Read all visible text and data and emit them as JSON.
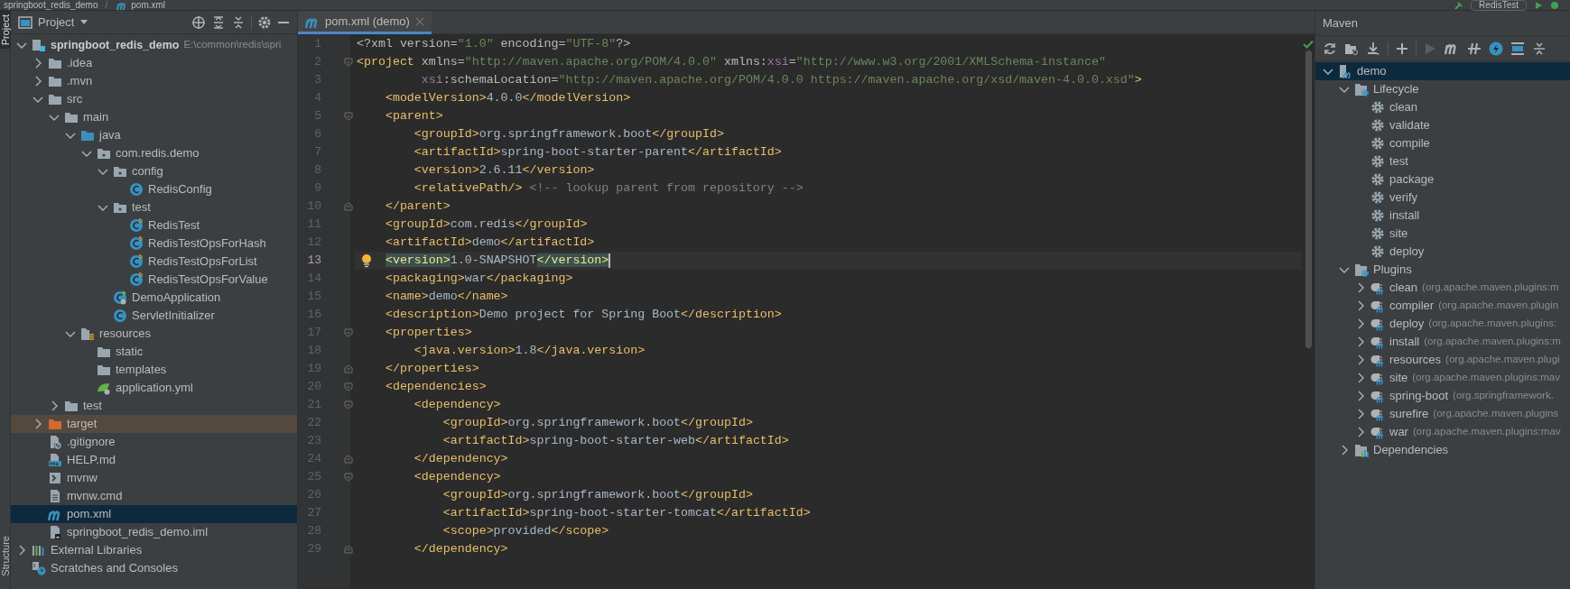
{
  "top_bar": {
    "separator": "/",
    "breadcrumbs": [
      {
        "label": "springboot_redis_demo",
        "kind": "module"
      },
      {
        "label": "pom.xml",
        "kind": "maven"
      }
    ],
    "run_config": "RedisTest"
  },
  "side_tabs": [
    {
      "label": "Project",
      "selected": true
    },
    {
      "label": "Structure",
      "selected": false
    }
  ],
  "project_panel": {
    "title": "Project",
    "tree": [
      {
        "label": "springboot_redis_demo",
        "hint": "E:\\common\\redis\\spri",
        "kind": "module",
        "expanded": true,
        "selected": false,
        "children": [
          {
            "label": ".idea",
            "kind": "folder",
            "expanded": false,
            "selected": false
          },
          {
            "label": ".mvn",
            "kind": "folder",
            "expanded": false,
            "selected": false
          },
          {
            "label": "src",
            "kind": "folder",
            "expanded": true,
            "selected": false,
            "children": [
              {
                "label": "main",
                "kind": "folder",
                "expanded": true,
                "selected": false,
                "children": [
                  {
                    "label": "java",
                    "kind": "source-folder",
                    "expanded": true,
                    "selected": false,
                    "children": [
                      {
                        "label": "com.redis.demo",
                        "kind": "package",
                        "expanded": true,
                        "selected": false,
                        "children": [
                          {
                            "label": "config",
                            "kind": "package",
                            "expanded": true,
                            "selected": false,
                            "children": [
                              {
                                "label": "RedisConfig",
                                "kind": "class",
                                "selected": false
                              }
                            ]
                          },
                          {
                            "label": "test",
                            "kind": "package",
                            "expanded": true,
                            "selected": false,
                            "children": [
                              {
                                "label": "RedisTest",
                                "kind": "test-class",
                                "selected": false
                              },
                              {
                                "label": "RedisTestOpsForHash",
                                "kind": "test-class",
                                "selected": false
                              },
                              {
                                "label": "RedisTestOpsForList",
                                "kind": "test-class",
                                "selected": false
                              },
                              {
                                "label": "RedisTestOpsForValue",
                                "kind": "test-class",
                                "selected": false
                              }
                            ]
                          },
                          {
                            "label": "DemoApplication",
                            "kind": "spring-class",
                            "selected": false
                          },
                          {
                            "label": "ServletInitializer",
                            "kind": "class",
                            "selected": false
                          }
                        ]
                      }
                    ]
                  },
                  {
                    "label": "resources",
                    "kind": "resources-folder",
                    "expanded": true,
                    "selected": false,
                    "children": [
                      {
                        "label": "static",
                        "kind": "folder",
                        "selected": false
                      },
                      {
                        "label": "templates",
                        "kind": "folder",
                        "selected": false
                      },
                      {
                        "label": "application.yml",
                        "kind": "spring-config",
                        "selected": false
                      }
                    ]
                  }
                ]
              },
              {
                "label": "test",
                "kind": "folder",
                "expanded": false,
                "selected": false
              }
            ]
          },
          {
            "label": "target",
            "kind": "excluded-folder",
            "expanded": false,
            "selected": false
          },
          {
            "label": ".gitignore",
            "kind": "gitignore",
            "selected": false
          },
          {
            "label": "HELP.md",
            "kind": "markdown",
            "selected": false
          },
          {
            "label": "mvnw",
            "kind": "shell",
            "selected": false
          },
          {
            "label": "mvnw.cmd",
            "kind": "text-file",
            "selected": false
          },
          {
            "label": "pom.xml",
            "kind": "maven",
            "selected": true
          },
          {
            "label": "springboot_redis_demo.iml",
            "kind": "iml",
            "selected": false
          }
        ]
      },
      {
        "label": "External Libraries",
        "kind": "libraries",
        "expanded": false,
        "selected": false
      },
      {
        "label": "Scratches and Consoles",
        "kind": "scratches",
        "selected": false
      }
    ]
  },
  "editor": {
    "tabs": [
      {
        "label": "pom.xml (demo)",
        "selected": true
      }
    ],
    "lines": [
      {
        "number": "1",
        "current": false,
        "segments": [
          {
            "kind": "attr",
            "text": "<?xml version="
          },
          {
            "kind": "value",
            "text": "\"1.0\""
          },
          {
            "kind": "attr",
            "text": " encoding="
          },
          {
            "kind": "value",
            "text": "\"UTF-8\""
          },
          {
            "kind": "attr",
            "text": "?>"
          }
        ]
      },
      {
        "number": "2",
        "current": false,
        "kind": "fold-start",
        "segments": [
          {
            "kind": "tag",
            "text": "<project"
          },
          {
            "kind": "attr",
            "text": " xmlns="
          },
          {
            "kind": "value",
            "text": "\"http://maven.apache.org/POM/4.0.0\""
          },
          {
            "kind": "attr",
            "text": " xmlns:"
          },
          {
            "kind": "ns",
            "text": "xsi"
          },
          {
            "kind": "attr",
            "text": "="
          },
          {
            "kind": "value",
            "text": "\"http://www.w3.org/2001/XMLSchema-instance\""
          }
        ]
      },
      {
        "number": "3",
        "current": false,
        "segments": [
          {
            "kind": "ns",
            "text": "         xsi"
          },
          {
            "kind": "attr",
            "text": ":schemaLocation="
          },
          {
            "kind": "value",
            "text": "\"http://maven.apache.org/POM/4.0.0 https://maven.apache.org/xsd/maven-4.0.0.xsd\""
          },
          {
            "kind": "tag",
            "text": ">"
          }
        ]
      },
      {
        "number": "4",
        "current": false,
        "segments": [
          {
            "kind": "tag",
            "text": "    <modelVersion>"
          },
          {
            "kind": "text",
            "text": "4.0.0"
          },
          {
            "kind": "tag",
            "text": "</modelVersion>"
          }
        ]
      },
      {
        "number": "5",
        "current": false,
        "kind": "fold-start",
        "segments": [
          {
            "kind": "tag",
            "text": "    <parent>"
          }
        ]
      },
      {
        "number": "6",
        "current": false,
        "segments": [
          {
            "kind": "tag",
            "text": "        <groupId>"
          },
          {
            "kind": "text",
            "text": "org.springframework.boot"
          },
          {
            "kind": "tag",
            "text": "</groupId>"
          }
        ]
      },
      {
        "number": "7",
        "current": false,
        "segments": [
          {
            "kind": "tag",
            "text": "        <artifactId>"
          },
          {
            "kind": "text",
            "text": "spring-boot-starter-parent"
          },
          {
            "kind": "tag",
            "text": "</artifactId>"
          }
        ]
      },
      {
        "number": "8",
        "current": false,
        "segments": [
          {
            "kind": "tag",
            "text": "        <version>"
          },
          {
            "kind": "text",
            "text": "2.6.11"
          },
          {
            "kind": "tag",
            "text": "</version>"
          }
        ]
      },
      {
        "number": "9",
        "current": false,
        "segments": [
          {
            "kind": "tag",
            "text": "        <relativePath/>"
          },
          {
            "kind": "comment",
            "text": " <!-- lookup parent from repository -->"
          }
        ]
      },
      {
        "number": "10",
        "current": false,
        "kind": "fold-end",
        "segments": [
          {
            "kind": "tag",
            "text": "    </parent>"
          }
        ]
      },
      {
        "number": "11",
        "current": false,
        "segments": [
          {
            "kind": "tag",
            "text": "    <groupId>"
          },
          {
            "kind": "text",
            "text": "com.redis"
          },
          {
            "kind": "tag",
            "text": "</groupId>"
          }
        ]
      },
      {
        "number": "12",
        "current": false,
        "segments": [
          {
            "kind": "tag",
            "text": "    <artifactId>"
          },
          {
            "kind": "text",
            "text": "demo"
          },
          {
            "kind": "tag",
            "text": "</artifactId>"
          }
        ]
      },
      {
        "number": "13",
        "current": true,
        "bulb": true,
        "segments": [
          {
            "kind": "tag",
            "text": "    <version>",
            "matched": true
          },
          {
            "kind": "text",
            "text": "1.0-SNAPSHOT"
          },
          {
            "kind": "tag",
            "text": "</version>",
            "matched": true
          }
        ]
      },
      {
        "number": "14",
        "current": false,
        "segments": [
          {
            "kind": "tag",
            "text": "    <packaging>"
          },
          {
            "kind": "text",
            "text": "war"
          },
          {
            "kind": "tag",
            "text": "</packaging>"
          }
        ]
      },
      {
        "number": "15",
        "current": false,
        "segments": [
          {
            "kind": "tag",
            "text": "    <name>"
          },
          {
            "kind": "text",
            "text": "demo"
          },
          {
            "kind": "tag",
            "text": "</name>"
          }
        ]
      },
      {
        "number": "16",
        "current": false,
        "segments": [
          {
            "kind": "tag",
            "text": "    <description>"
          },
          {
            "kind": "text",
            "text": "Demo project for Spring Boot"
          },
          {
            "kind": "tag",
            "text": "</description>"
          }
        ]
      },
      {
        "number": "17",
        "current": false,
        "kind": "fold-start",
        "segments": [
          {
            "kind": "tag",
            "text": "    <properties>"
          }
        ]
      },
      {
        "number": "18",
        "current": false,
        "segments": [
          {
            "kind": "tag",
            "text": "        <java.version>"
          },
          {
            "kind": "text",
            "text": "1.8"
          },
          {
            "kind": "tag",
            "text": "</java.version>"
          }
        ]
      },
      {
        "number": "19",
        "current": false,
        "kind": "fold-end",
        "segments": [
          {
            "kind": "tag",
            "text": "    </properties>"
          }
        ]
      },
      {
        "number": "20",
        "current": false,
        "kind": "fold-start",
        "segments": [
          {
            "kind": "tag",
            "text": "    <dependencies>"
          }
        ]
      },
      {
        "number": "21",
        "current": false,
        "kind": "fold-start",
        "segments": [
          {
            "kind": "tag",
            "text": "        <dependency>"
          }
        ]
      },
      {
        "number": "22",
        "current": false,
        "segments": [
          {
            "kind": "tag",
            "text": "            <groupId>"
          },
          {
            "kind": "text",
            "text": "org.springframework.boot"
          },
          {
            "kind": "tag",
            "text": "</groupId>"
          }
        ]
      },
      {
        "number": "23",
        "current": false,
        "segments": [
          {
            "kind": "tag",
            "text": "            <artifactId>"
          },
          {
            "kind": "text",
            "text": "spring-boot-starter-web"
          },
          {
            "kind": "tag",
            "text": "</artifactId>"
          }
        ]
      },
      {
        "number": "24",
        "current": false,
        "kind": "fold-end",
        "segments": [
          {
            "kind": "tag",
            "text": "        </dependency>"
          }
        ]
      },
      {
        "number": "25",
        "current": false,
        "kind": "fold-start",
        "segments": [
          {
            "kind": "tag",
            "text": "        <dependency>"
          }
        ]
      },
      {
        "number": "26",
        "current": false,
        "segments": [
          {
            "kind": "tag",
            "text": "            <groupId>"
          },
          {
            "kind": "text",
            "text": "org.springframework.boot"
          },
          {
            "kind": "tag",
            "text": "</groupId>"
          }
        ]
      },
      {
        "number": "27",
        "current": false,
        "segments": [
          {
            "kind": "tag",
            "text": "            <artifactId>"
          },
          {
            "kind": "text",
            "text": "spring-boot-starter-tomcat"
          },
          {
            "kind": "tag",
            "text": "</artifactId>"
          }
        ]
      },
      {
        "number": "28",
        "current": false,
        "segments": [
          {
            "kind": "tag",
            "text": "            <scope>"
          },
          {
            "kind": "text",
            "text": "provided"
          },
          {
            "kind": "tag",
            "text": "</scope>"
          }
        ]
      },
      {
        "number": "29",
        "current": false,
        "kind": "fold-end",
        "segments": [
          {
            "kind": "tag",
            "text": "        </dependency>"
          }
        ]
      }
    ]
  },
  "maven_panel": {
    "title": "Maven",
    "tree": [
      {
        "label": "demo",
        "kind": "maven-module",
        "expanded": true,
        "selected": true,
        "children": [
          {
            "label": "Lifecycle",
            "kind": "settings-folder",
            "expanded": true,
            "selected": false,
            "children": [
              {
                "label": "clean",
                "kind": "goal",
                "selected": false
              },
              {
                "label": "validate",
                "kind": "goal",
                "selected": false
              },
              {
                "label": "compile",
                "kind": "goal",
                "selected": false
              },
              {
                "label": "test",
                "kind": "goal",
                "selected": false
              },
              {
                "label": "package",
                "kind": "goal",
                "selected": false
              },
              {
                "label": "verify",
                "kind": "goal",
                "selected": false
              },
              {
                "label": "install",
                "kind": "goal",
                "selected": false
              },
              {
                "label": "site",
                "kind": "goal",
                "selected": false
              },
              {
                "label": "deploy",
                "kind": "goal",
                "selected": false
              }
            ]
          },
          {
            "label": "Plugins",
            "kind": "settings-folder",
            "expanded": true,
            "selected": false,
            "children": [
              {
                "label": "clean",
                "hint": "(org.apache.maven.plugins:m",
                "kind": "plugin",
                "expanded": false,
                "selected": false
              },
              {
                "label": "compiler",
                "hint": "(org.apache.maven.plugin",
                "kind": "plugin",
                "expanded": false,
                "selected": false
              },
              {
                "label": "deploy",
                "hint": "(org.apache.maven.plugins:",
                "kind": "plugin",
                "expanded": false,
                "selected": false
              },
              {
                "label": "install",
                "hint": "(org.apache.maven.plugins:m",
                "kind": "plugin",
                "expanded": false,
                "selected": false
              },
              {
                "label": "resources",
                "hint": "(org.apache.maven.plugi",
                "kind": "plugin",
                "expanded": false,
                "selected": false
              },
              {
                "label": "site",
                "hint": "(org.apache.maven.plugins:mav",
                "kind": "plugin",
                "expanded": false,
                "selected": false
              },
              {
                "label": "spring-boot",
                "hint": "(org.springframework.",
                "kind": "plugin",
                "expanded": false,
                "selected": false
              },
              {
                "label": "surefire",
                "hint": "(org.apache.maven.plugins",
                "kind": "plugin",
                "expanded": false,
                "selected": false
              },
              {
                "label": "war",
                "hint": "(org.apache.maven.plugins:mav",
                "kind": "plugin",
                "expanded": false,
                "selected": false
              }
            ]
          },
          {
            "label": "Dependencies",
            "kind": "dependencies",
            "expanded": false,
            "selected": false
          }
        ]
      }
    ]
  }
}
